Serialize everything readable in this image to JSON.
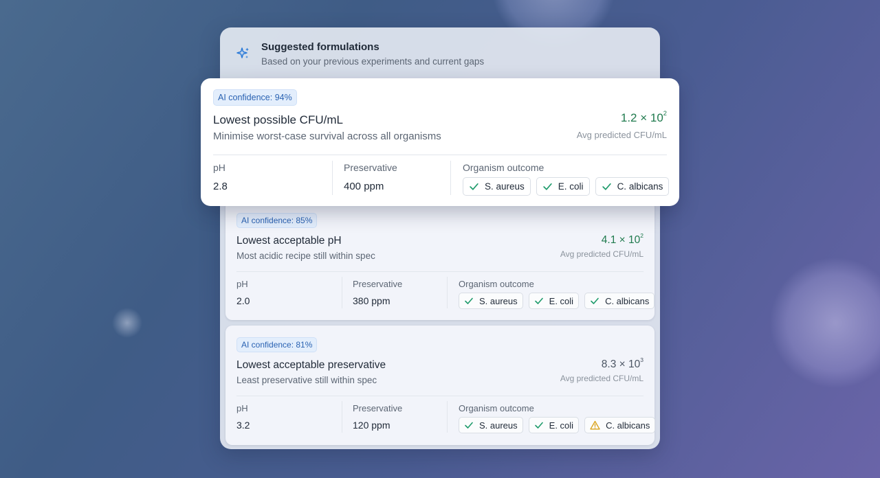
{
  "header": {
    "title": "Suggested formulations",
    "subtitle": "Based on your previous experiments and current gaps",
    "icon": "sparkle-icon"
  },
  "colors": {
    "accent_blue": "#2a62b2",
    "value_green": "#1f7a4d",
    "check_green": "#1e9b6b",
    "warning_amber": "#d9a21b",
    "value_neutral": "#4b5563"
  },
  "labels": {
    "ph": "pH",
    "preservative": "Preservative",
    "organism_outcome": "Organism outcome",
    "value_caption": "Avg predicted CFU/mL"
  },
  "cards": [
    {
      "confidence": "AI confidence: 94%",
      "title": "Lowest possible CFU/mL",
      "description": "Minimise worst-case survival across all organisms",
      "value_base": "1.2 × 10",
      "value_exp": "2",
      "value_tone": "green",
      "ph": "2.8",
      "preservative": "400 ppm",
      "organisms": [
        {
          "name": "S. aureus",
          "status": "pass"
        },
        {
          "name": "E. coli",
          "status": "pass"
        },
        {
          "name": "C. albicans",
          "status": "pass"
        }
      ]
    },
    {
      "confidence": "AI confidence: 85%",
      "title": "Lowest acceptable pH",
      "description": "Most acidic recipe still within spec",
      "value_base": "4.1 × 10",
      "value_exp": "2",
      "value_tone": "green",
      "ph": "2.0",
      "preservative": "380 ppm",
      "organisms": [
        {
          "name": "S. aureus",
          "status": "pass"
        },
        {
          "name": "E. coli",
          "status": "pass"
        },
        {
          "name": "C. albicans",
          "status": "pass"
        }
      ]
    },
    {
      "confidence": "AI confidence: 81%",
      "title": "Lowest acceptable preservative",
      "description": "Least preservative still within spec",
      "value_base": "8.3 × 10",
      "value_exp": "3",
      "value_tone": "neutral",
      "ph": "3.2",
      "preservative": "120 ppm",
      "organisms": [
        {
          "name": "S. aureus",
          "status": "pass"
        },
        {
          "name": "E. coli",
          "status": "pass"
        },
        {
          "name": "C. albicans",
          "status": "warning"
        }
      ]
    }
  ]
}
